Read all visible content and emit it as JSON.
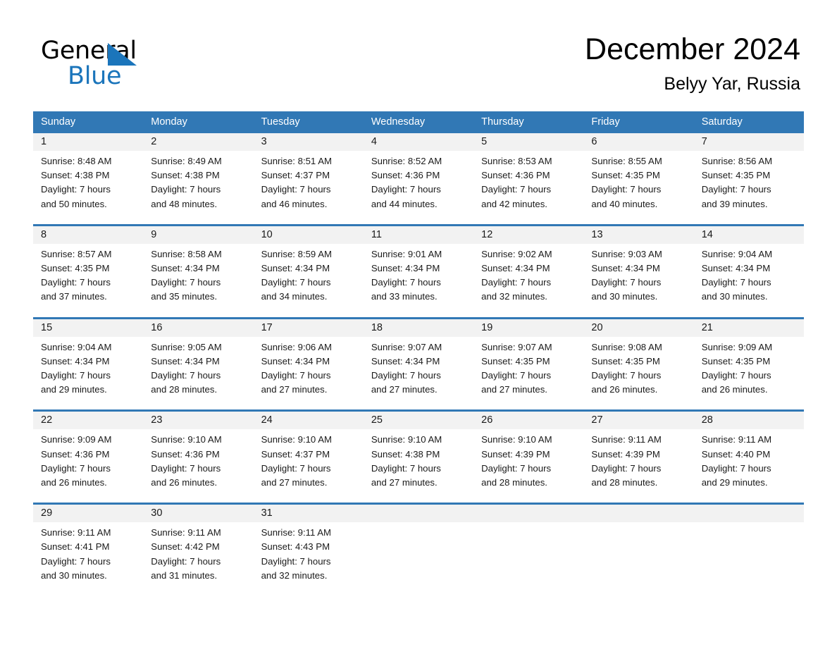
{
  "brand": {
    "name_top": "General",
    "name_bottom": "Blue",
    "triangle_icon": "triangle-icon",
    "accent_color": "#1b75bb"
  },
  "header": {
    "title": "December 2024",
    "location": "Belyy Yar, Russia"
  },
  "calendar": {
    "header_bg": "#3178b5",
    "daynum_bg": "#f2f2f2",
    "weekdays": [
      "Sunday",
      "Monday",
      "Tuesday",
      "Wednesday",
      "Thursday",
      "Friday",
      "Saturday"
    ],
    "weeks": [
      [
        {
          "day": "1",
          "lines": [
            "Sunrise: 8:48 AM",
            "Sunset: 4:38 PM",
            "Daylight: 7 hours",
            "and 50 minutes."
          ]
        },
        {
          "day": "2",
          "lines": [
            "Sunrise: 8:49 AM",
            "Sunset: 4:38 PM",
            "Daylight: 7 hours",
            "and 48 minutes."
          ]
        },
        {
          "day": "3",
          "lines": [
            "Sunrise: 8:51 AM",
            "Sunset: 4:37 PM",
            "Daylight: 7 hours",
            "and 46 minutes."
          ]
        },
        {
          "day": "4",
          "lines": [
            "Sunrise: 8:52 AM",
            "Sunset: 4:36 PM",
            "Daylight: 7 hours",
            "and 44 minutes."
          ]
        },
        {
          "day": "5",
          "lines": [
            "Sunrise: 8:53 AM",
            "Sunset: 4:36 PM",
            "Daylight: 7 hours",
            "and 42 minutes."
          ]
        },
        {
          "day": "6",
          "lines": [
            "Sunrise: 8:55 AM",
            "Sunset: 4:35 PM",
            "Daylight: 7 hours",
            "and 40 minutes."
          ]
        },
        {
          "day": "7",
          "lines": [
            "Sunrise: 8:56 AM",
            "Sunset: 4:35 PM",
            "Daylight: 7 hours",
            "and 39 minutes."
          ]
        }
      ],
      [
        {
          "day": "8",
          "lines": [
            "Sunrise: 8:57 AM",
            "Sunset: 4:35 PM",
            "Daylight: 7 hours",
            "and 37 minutes."
          ]
        },
        {
          "day": "9",
          "lines": [
            "Sunrise: 8:58 AM",
            "Sunset: 4:34 PM",
            "Daylight: 7 hours",
            "and 35 minutes."
          ]
        },
        {
          "day": "10",
          "lines": [
            "Sunrise: 8:59 AM",
            "Sunset: 4:34 PM",
            "Daylight: 7 hours",
            "and 34 minutes."
          ]
        },
        {
          "day": "11",
          "lines": [
            "Sunrise: 9:01 AM",
            "Sunset: 4:34 PM",
            "Daylight: 7 hours",
            "and 33 minutes."
          ]
        },
        {
          "day": "12",
          "lines": [
            "Sunrise: 9:02 AM",
            "Sunset: 4:34 PM",
            "Daylight: 7 hours",
            "and 32 minutes."
          ]
        },
        {
          "day": "13",
          "lines": [
            "Sunrise: 9:03 AM",
            "Sunset: 4:34 PM",
            "Daylight: 7 hours",
            "and 30 minutes."
          ]
        },
        {
          "day": "14",
          "lines": [
            "Sunrise: 9:04 AM",
            "Sunset: 4:34 PM",
            "Daylight: 7 hours",
            "and 30 minutes."
          ]
        }
      ],
      [
        {
          "day": "15",
          "lines": [
            "Sunrise: 9:04 AM",
            "Sunset: 4:34 PM",
            "Daylight: 7 hours",
            "and 29 minutes."
          ]
        },
        {
          "day": "16",
          "lines": [
            "Sunrise: 9:05 AM",
            "Sunset: 4:34 PM",
            "Daylight: 7 hours",
            "and 28 minutes."
          ]
        },
        {
          "day": "17",
          "lines": [
            "Sunrise: 9:06 AM",
            "Sunset: 4:34 PM",
            "Daylight: 7 hours",
            "and 27 minutes."
          ]
        },
        {
          "day": "18",
          "lines": [
            "Sunrise: 9:07 AM",
            "Sunset: 4:34 PM",
            "Daylight: 7 hours",
            "and 27 minutes."
          ]
        },
        {
          "day": "19",
          "lines": [
            "Sunrise: 9:07 AM",
            "Sunset: 4:35 PM",
            "Daylight: 7 hours",
            "and 27 minutes."
          ]
        },
        {
          "day": "20",
          "lines": [
            "Sunrise: 9:08 AM",
            "Sunset: 4:35 PM",
            "Daylight: 7 hours",
            "and 26 minutes."
          ]
        },
        {
          "day": "21",
          "lines": [
            "Sunrise: 9:09 AM",
            "Sunset: 4:35 PM",
            "Daylight: 7 hours",
            "and 26 minutes."
          ]
        }
      ],
      [
        {
          "day": "22",
          "lines": [
            "Sunrise: 9:09 AM",
            "Sunset: 4:36 PM",
            "Daylight: 7 hours",
            "and 26 minutes."
          ]
        },
        {
          "day": "23",
          "lines": [
            "Sunrise: 9:10 AM",
            "Sunset: 4:36 PM",
            "Daylight: 7 hours",
            "and 26 minutes."
          ]
        },
        {
          "day": "24",
          "lines": [
            "Sunrise: 9:10 AM",
            "Sunset: 4:37 PM",
            "Daylight: 7 hours",
            "and 27 minutes."
          ]
        },
        {
          "day": "25",
          "lines": [
            "Sunrise: 9:10 AM",
            "Sunset: 4:38 PM",
            "Daylight: 7 hours",
            "and 27 minutes."
          ]
        },
        {
          "day": "26",
          "lines": [
            "Sunrise: 9:10 AM",
            "Sunset: 4:39 PM",
            "Daylight: 7 hours",
            "and 28 minutes."
          ]
        },
        {
          "day": "27",
          "lines": [
            "Sunrise: 9:11 AM",
            "Sunset: 4:39 PM",
            "Daylight: 7 hours",
            "and 28 minutes."
          ]
        },
        {
          "day": "28",
          "lines": [
            "Sunrise: 9:11 AM",
            "Sunset: 4:40 PM",
            "Daylight: 7 hours",
            "and 29 minutes."
          ]
        }
      ],
      [
        {
          "day": "29",
          "lines": [
            "Sunrise: 9:11 AM",
            "Sunset: 4:41 PM",
            "Daylight: 7 hours",
            "and 30 minutes."
          ]
        },
        {
          "day": "30",
          "lines": [
            "Sunrise: 9:11 AM",
            "Sunset: 4:42 PM",
            "Daylight: 7 hours",
            "and 31 minutes."
          ]
        },
        {
          "day": "31",
          "lines": [
            "Sunrise: 9:11 AM",
            "Sunset: 4:43 PM",
            "Daylight: 7 hours",
            "and 32 minutes."
          ]
        },
        {
          "day": "",
          "lines": []
        },
        {
          "day": "",
          "lines": []
        },
        {
          "day": "",
          "lines": []
        },
        {
          "day": "",
          "lines": []
        }
      ]
    ]
  }
}
